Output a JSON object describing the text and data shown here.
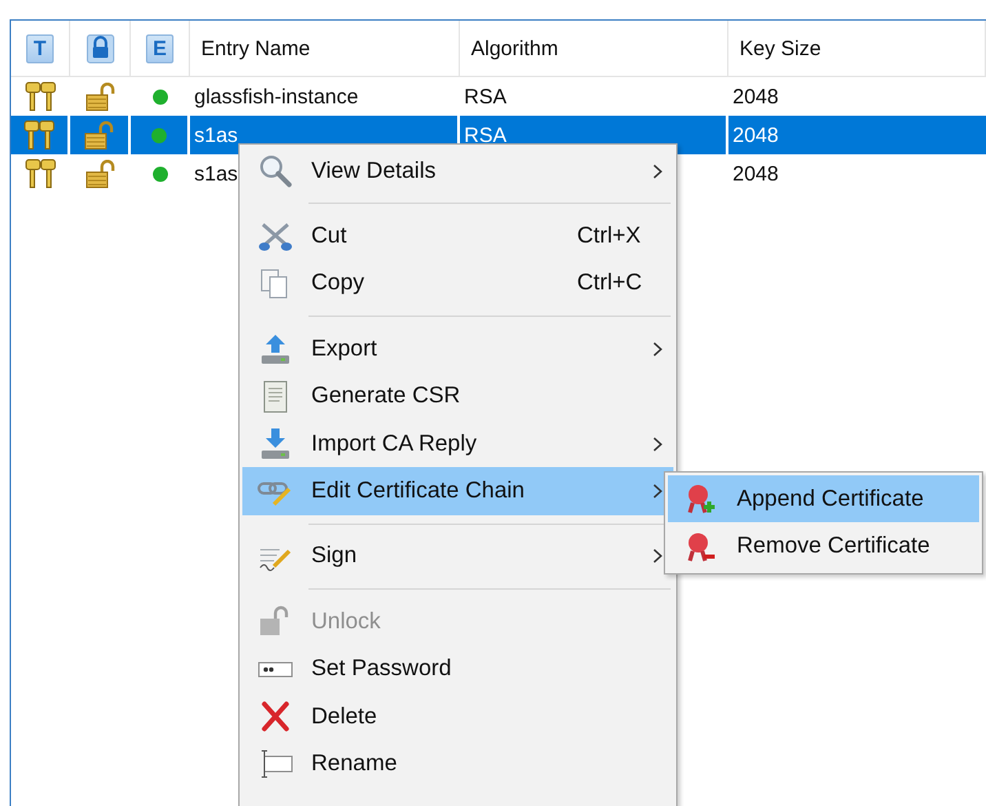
{
  "table": {
    "columns": [
      {
        "kind": "letter",
        "label": "T"
      },
      {
        "kind": "lock"
      },
      {
        "kind": "letter",
        "label": "E"
      },
      {
        "kind": "text",
        "label": "Entry Name"
      },
      {
        "kind": "text",
        "label": "Algorithm"
      },
      {
        "kind": "text",
        "label": "Key Size"
      }
    ],
    "rows": [
      {
        "selected": false,
        "locked": false,
        "color": "#1fb02e",
        "name": "glassfish-instance",
        "algorithm": "RSA",
        "key_size": "2048"
      },
      {
        "selected": true,
        "locked": false,
        "color": "#1fb02e",
        "name": "s1as",
        "algorithm": "RSA",
        "key_size": "2048"
      },
      {
        "selected": false,
        "locked": false,
        "color": "#1fb02e",
        "name": "s1as",
        "key_size": "2048"
      }
    ]
  },
  "context_menu": {
    "items": [
      {
        "kind": "item",
        "label": "View Details",
        "submenu": true,
        "disabled": false,
        "selected": false
      },
      {
        "kind": "separator"
      },
      {
        "kind": "item",
        "label": "Cut",
        "shortcut": "Ctrl+X",
        "submenu": false,
        "disabled": false,
        "selected": false
      },
      {
        "kind": "item",
        "label": "Copy",
        "shortcut": "Ctrl+C",
        "submenu": false,
        "disabled": false,
        "selected": false
      },
      {
        "kind": "separator"
      },
      {
        "kind": "item",
        "label": "Export",
        "submenu": true,
        "disabled": false,
        "selected": false
      },
      {
        "kind": "item",
        "label": "Generate CSR",
        "submenu": false,
        "disabled": false,
        "selected": false
      },
      {
        "kind": "item",
        "label": "Import CA Reply",
        "submenu": true,
        "disabled": false,
        "selected": false
      },
      {
        "kind": "item",
        "label": "Edit Certificate Chain",
        "submenu": true,
        "disabled": false,
        "selected": true
      },
      {
        "kind": "separator"
      },
      {
        "kind": "item",
        "label": "Sign",
        "submenu": true,
        "disabled": false,
        "selected": false
      },
      {
        "kind": "separator"
      },
      {
        "kind": "item",
        "label": "Unlock",
        "submenu": false,
        "disabled": true,
        "selected": false
      },
      {
        "kind": "item",
        "label": "Set Password",
        "submenu": false,
        "disabled": false,
        "selected": false
      },
      {
        "kind": "item",
        "label": "Delete",
        "submenu": false,
        "disabled": false,
        "selected": false
      },
      {
        "kind": "item",
        "label": "Rename",
        "submenu": false,
        "disabled": false,
        "selected": false
      }
    ]
  },
  "submenu": {
    "items": [
      {
        "label": "Append Certificate",
        "selected": true
      },
      {
        "label": "Remove Certificate",
        "selected": false
      }
    ]
  }
}
